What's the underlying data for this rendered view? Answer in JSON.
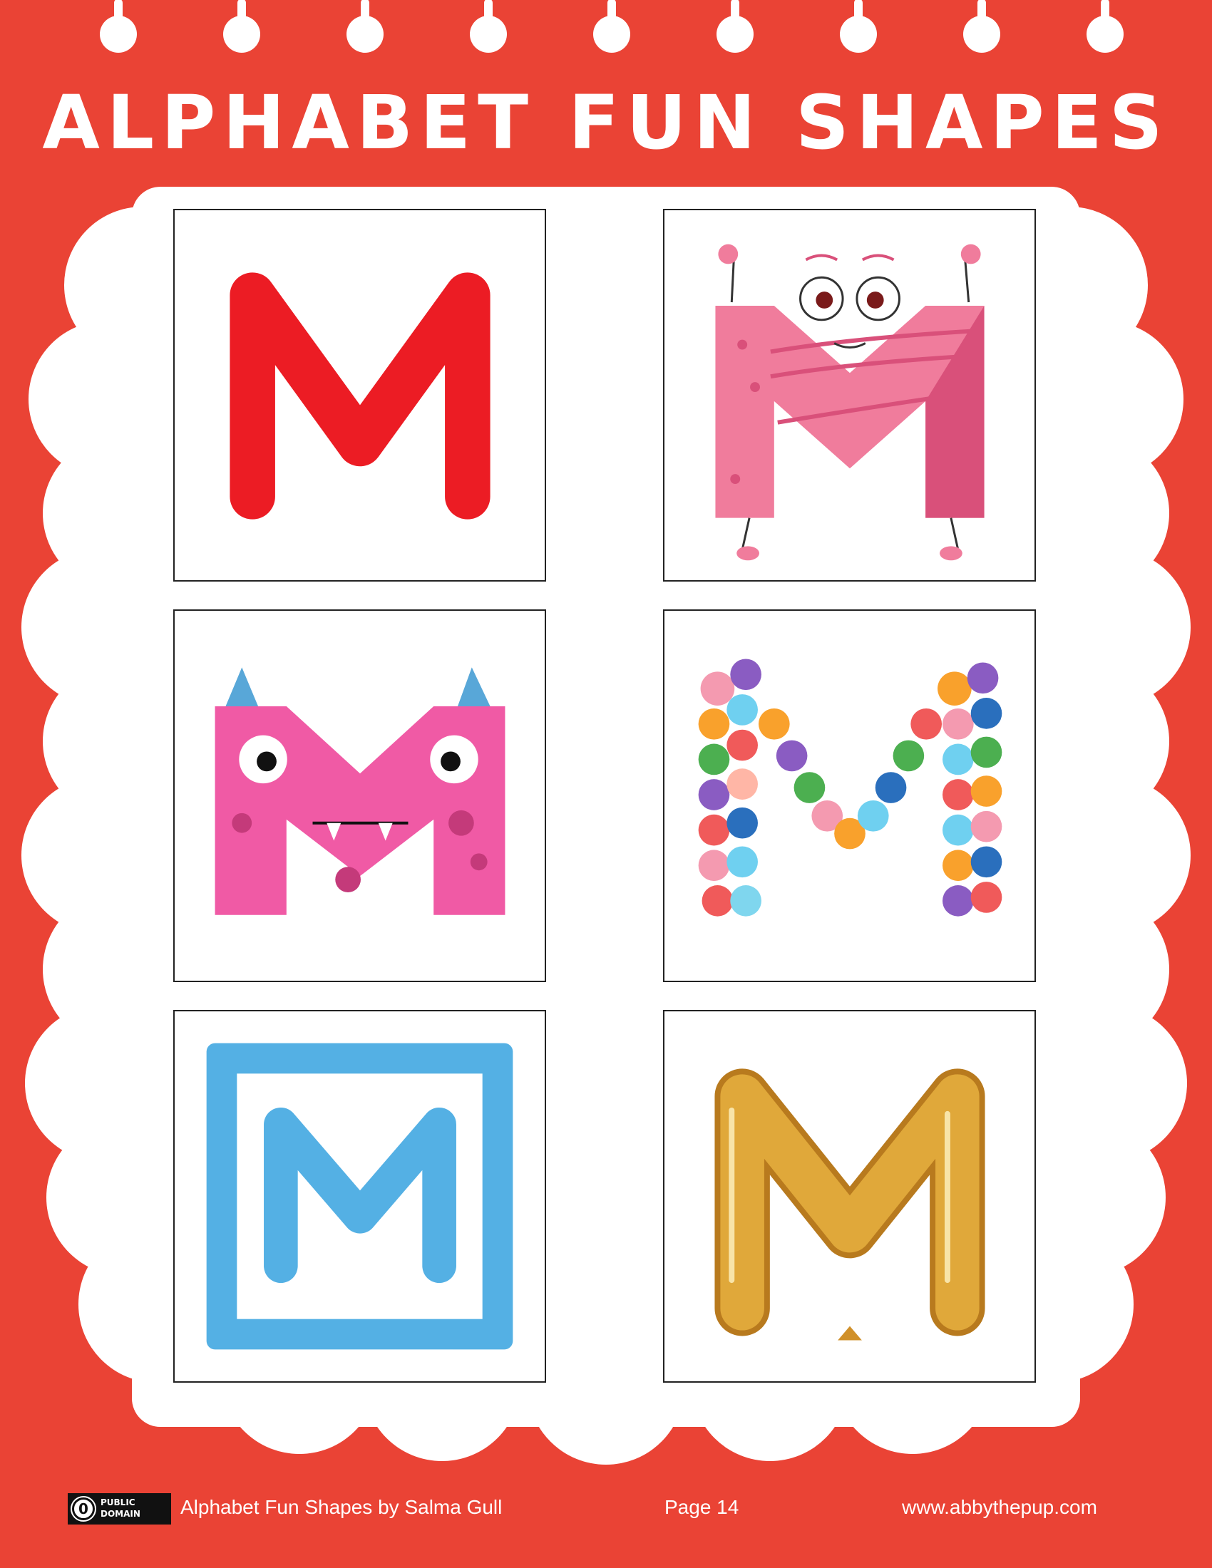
{
  "header": {
    "title": "Alphabet Fun Shapes"
  },
  "cards": [
    {
      "letter": "M",
      "style": "plain-red-letter",
      "color": "#ec1c24"
    },
    {
      "letter": "M",
      "style": "pink-character-with-arms-legs",
      "color": "#f07c9c"
    },
    {
      "letter": "M",
      "style": "pink-monster-with-horns",
      "color": "#f05aa5"
    },
    {
      "letter": "M",
      "style": "colorful-balls",
      "color": "#f9a12c"
    },
    {
      "letter": "M",
      "style": "blue-block",
      "color": "#54b0e4"
    },
    {
      "letter": "M",
      "style": "gold-balloon",
      "color": "#e0a83a"
    }
  ],
  "footer": {
    "license_badge": "PUBLIC DOMAIN",
    "license_symbol": "0",
    "credit": "Alphabet Fun Shapes by Salma Gull",
    "page": "Page 14",
    "website": "www.abbythepup.com"
  },
  "colors": {
    "background": "#ea4335",
    "cloud": "#ffffff",
    "red_letter": "#ec1c24",
    "blue_block": "#54b0e4"
  }
}
